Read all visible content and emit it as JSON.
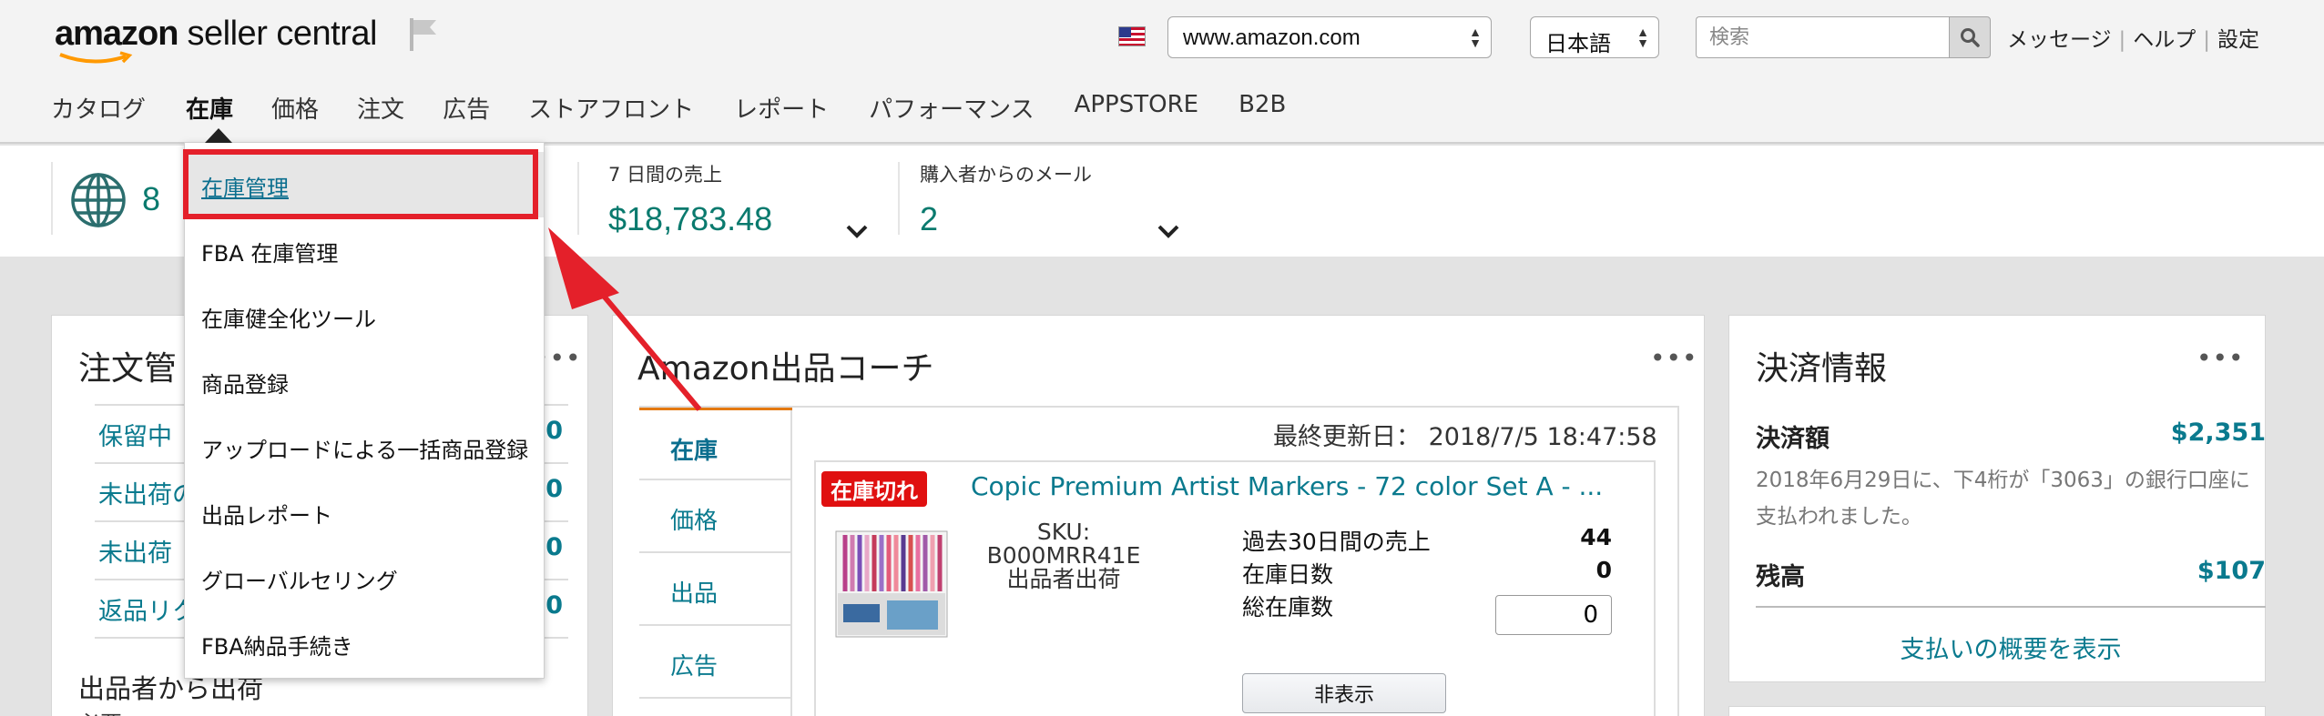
{
  "header": {
    "logo_bold": "amazon",
    "logo_rest": " seller central",
    "marketplace": "www.amazon.com",
    "language": "日本語",
    "search_placeholder": "検索",
    "links": [
      "メッセージ",
      "ヘルプ",
      "設定"
    ]
  },
  "nav": [
    "カタログ",
    "在庫",
    "価格",
    "注文",
    "広告",
    "ストアフロント",
    "レポート",
    "パフォーマンス",
    "APPSTORE",
    "B2B"
  ],
  "nav_active": "在庫",
  "stats": {
    "marketplaces_count": "8",
    "sales_label": "7 日間の売上",
    "sales_value": "$18,783.48",
    "mail_label": "購入者からのメール",
    "mail_value": "2"
  },
  "order_card": {
    "title": "注文管",
    "rows": [
      {
        "label": "保留中",
        "count": "0"
      },
      {
        "label": "未出荷の",
        "count": "0"
      },
      {
        "label": "未出荷",
        "count": "0"
      },
      {
        "label": "返品リク",
        "count": "0"
      }
    ],
    "footer_title": "出品者から出荷",
    "footer_sub": "必要"
  },
  "coach_card": {
    "title": "Amazon出品コーチ",
    "last_updated_label": "最終更新日：",
    "last_updated_value": "2018/7/5 18:47:58",
    "tabs": [
      "在庫",
      "価格",
      "出品",
      "広告"
    ],
    "product": {
      "badge": "在庫切れ",
      "title": "Copic Premium Artist Markers - 72 color Set A - ...",
      "sku": "SKU: B000MRR41E",
      "fulfillment": "出品者出荷",
      "metrics": [
        {
          "label": "過去30日間の売上",
          "value": "44"
        },
        {
          "label": "在庫日数",
          "value": "0"
        }
      ],
      "stock_label": "総在庫数",
      "stock_value": "0",
      "hide_button": "非表示"
    }
  },
  "payment_card": {
    "title": "決済情報",
    "amount_label": "決済額",
    "amount_value": "$2,351",
    "note": "2018年6月29日に、下4桁が「3063」の銀行口座に支払われました。",
    "balance_label": "残高",
    "balance_value": "$107",
    "summary_link": "支払いの概要を表示"
  },
  "inventory_menu": [
    "在庫管理",
    "FBA 在庫管理",
    "在庫健全化ツール",
    "商品登録",
    "アップロードによる一括商品登録",
    "出品レポート",
    "グローバルセリング",
    "FBA納品手続き"
  ],
  "colors": {
    "accent_teal": "#0a7a8e",
    "highlight_red": "#e4202a",
    "badge_red": "#e01010",
    "tab_orange": "#e47911"
  }
}
